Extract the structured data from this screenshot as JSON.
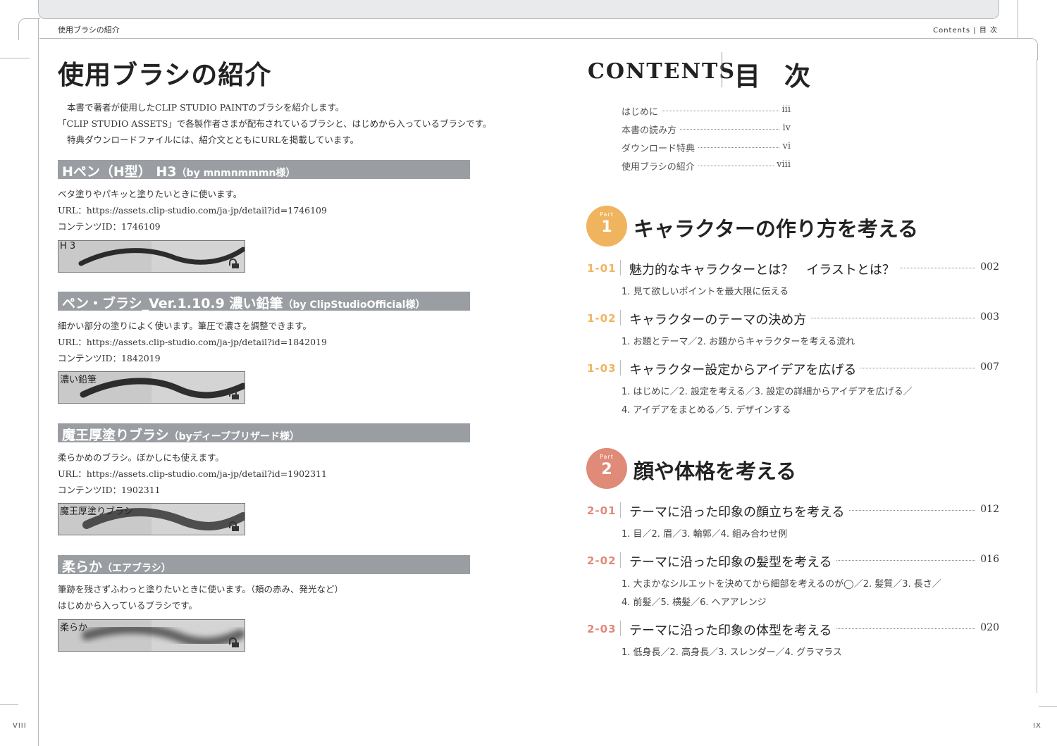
{
  "colors": {
    "part1": "#f0b35e",
    "part2": "#e08a78",
    "bar": "#9a9ea2"
  },
  "running_head": {
    "left": "使用ブラシの紹介",
    "right": "Contents | 目 次"
  },
  "folios": {
    "left": "VIII",
    "right": "IX"
  },
  "left": {
    "title": "使用ブラシの紹介",
    "intro": [
      "本書で著者が使用したCLIP STUDIO PAINTのブラシを紹介します。",
      "「CLIP STUDIO ASSETS」で各製作者さまが配布されているブラシと、はじめから入っているブラシです。",
      "特典ダウンロードファイルには、紹介文とともにURLを掲載しています。"
    ],
    "brushes": [
      {
        "name": "Hペン（H型） H3",
        "by": "（by mnmnmmmn様）",
        "desc": "ベタ塗りやパキッと塗りたいときに使います。",
        "url": "URL：https://assets.clip-studio.com/ja-jp/detail?id=1746109",
        "id": "コンテンツID：1746109",
        "preview_label": "H 3"
      },
      {
        "name": "ペン・ブラシ_Ver.1.10.9 濃い鉛筆",
        "by": "（by ClipStudioOfficial様）",
        "desc": "細かい部分の塗りによく使います。筆圧で濃さを調整できます。",
        "url": "URL：https://assets.clip-studio.com/ja-jp/detail?id=1842019",
        "id": "コンテンツID：1842019",
        "preview_label": "濃い鉛筆"
      },
      {
        "name": "魔王厚塗りブラシ",
        "by": "（byディープブリザード様）",
        "desc": "柔らかめのブラシ。ぼかしにも使えます。",
        "url": "URL：https://assets.clip-studio.com/ja-jp/detail?id=1902311",
        "id": "コンテンツID：1902311",
        "preview_label": "魔王厚塗りブラシ"
      },
      {
        "name": "柔らか",
        "by": "（エアブラシ）",
        "desc": "筆跡を残さずふわっと塗りたいときに使います。（頬の赤み、発光など）",
        "url": "はじめから入っているブラシです。",
        "id": "",
        "preview_label": "柔らか"
      }
    ]
  },
  "right": {
    "title_en": "Contents",
    "title_jp": "目次",
    "front": [
      {
        "label": "はじめに",
        "page": "iii"
      },
      {
        "label": "本書の読み方",
        "page": "iv"
      },
      {
        "label": "ダウンロード特典",
        "page": "vi"
      },
      {
        "label": "使用ブラシの紹介",
        "page": "viii"
      }
    ],
    "parts": [
      {
        "word": "Part",
        "number": "1",
        "title": "キャラクターの作り方を考える",
        "sections": [
          {
            "num": "1-01",
            "title": "魅力的なキャラクターとは？　イラストとは？",
            "page": "002",
            "subs": [
              "1. 見て欲しいポイントを最大限に伝える"
            ]
          },
          {
            "num": "1-02",
            "title": "キャラクターのテーマの決め方",
            "page": "003",
            "subs": [
              "1. お題とテーマ／2. お題からキャラクターを考える流れ"
            ]
          },
          {
            "num": "1-03",
            "title": "キャラクター設定からアイデアを広げる",
            "page": "007",
            "subs": [
              "1. はじめに／2. 設定を考える／3. 設定の詳細からアイデアを広げる／",
              "4. アイデアをまとめる／5. デザインする"
            ]
          }
        ]
      },
      {
        "word": "Part",
        "number": "2",
        "title": "顔や体格を考える",
        "sections": [
          {
            "num": "2-01",
            "title": "テーマに沿った印象の顔立ちを考える",
            "page": "012",
            "subs": [
              "1. 目／2. 眉／3. 輪郭／4. 組み合わせ例"
            ]
          },
          {
            "num": "2-02",
            "title": "テーマに沿った印象の髪型を考える",
            "page": "016",
            "subs": [
              "1. 大まかなシルエットを決めてから細部を考えるのが◯／2. 髪質／3. 長さ／",
              "4. 前髪／5. 横髪／6. ヘアアレンジ"
            ]
          },
          {
            "num": "2-03",
            "title": "テーマに沿った印象の体型を考える",
            "page": "020",
            "subs": [
              "1. 低身長／2. 高身長／3. スレンダー／4. グラマラス"
            ]
          }
        ]
      }
    ]
  }
}
